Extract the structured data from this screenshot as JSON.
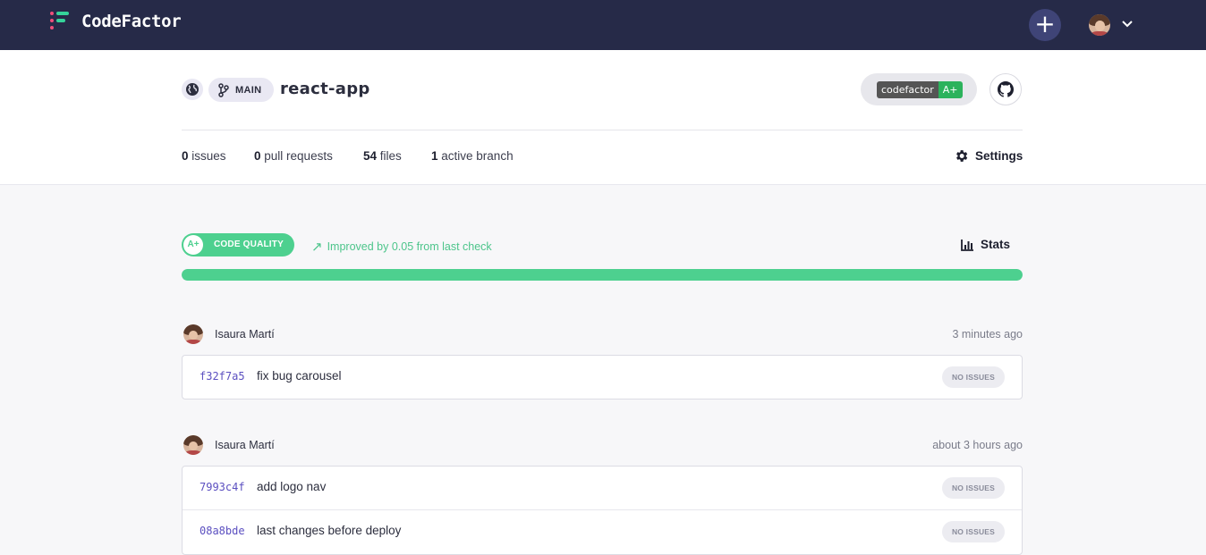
{
  "app": {
    "brand": "CodeFactor"
  },
  "topbar": {
    "add_symbol": "+"
  },
  "repo": {
    "branch_label": "MAIN",
    "name": "react-app",
    "badge_left": "codefactor",
    "badge_right": "A+"
  },
  "stats": [
    {
      "count": "0",
      "label": "issues"
    },
    {
      "count": "0",
      "label": "pull requests"
    },
    {
      "count": "54",
      "label": "files"
    },
    {
      "count": "1",
      "label": "active branch"
    }
  ],
  "settings_label": "Settings",
  "quality": {
    "grade": "A+",
    "label": "CODE QUALITY",
    "improvement": "Improved by 0.05 from last check",
    "stats_label": "Stats",
    "progress_percent": 100
  },
  "colors": {
    "accent_green": "#4dd08f",
    "nav_bg": "#262a48",
    "sha_purple": "#5b4fc0"
  },
  "icons": {
    "globe": "globe-icon",
    "branch": "branch-icon",
    "github": "github-icon",
    "gear": "gear-icon",
    "chart": "bar-chart-icon",
    "arrow": "trend-up-arrow-icon",
    "caret": "chevron-down-icon"
  },
  "commit_groups": [
    {
      "author": "Isaura Martí",
      "time": "3 minutes ago",
      "commits": [
        {
          "sha": "f32f7a5",
          "message": "fix bug carousel",
          "status": "NO ISSUES"
        }
      ]
    },
    {
      "author": "Isaura Martí",
      "time": "about 3 hours ago",
      "commits": [
        {
          "sha": "7993c4f",
          "message": "add logo nav",
          "status": "NO ISSUES"
        },
        {
          "sha": "08a8bde",
          "message": "last changes before deploy",
          "status": "NO ISSUES"
        }
      ]
    }
  ]
}
